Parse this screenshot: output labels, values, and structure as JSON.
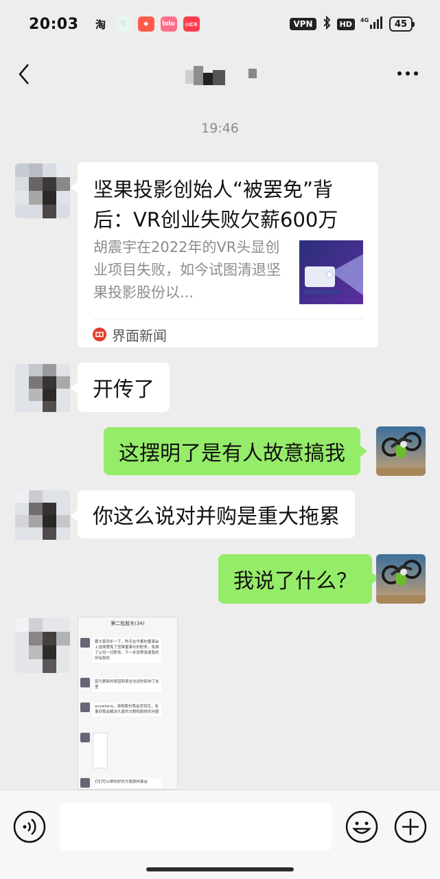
{
  "status_bar": {
    "time": "20:03",
    "app_icons": [
      "淘",
      "♡",
      "◆",
      "lolo",
      "小红书"
    ],
    "vpn": "VPN",
    "bluetooth": "bluetooth-icon",
    "hd": "HD",
    "signal": "⁴ᴳ.ıl",
    "battery": "45"
  },
  "nav": {
    "back_icon": "chevron-left-icon",
    "more_icon": "more-horizontal-icon"
  },
  "chat": {
    "timestamp": "19:46",
    "link_card": {
      "title": "坚果投影创始人“被罢免”背后：VR创业失败欠薪600万",
      "description": "胡震宇在2022年的VR头显创业项目失败，如今试图清退坚果投影股份以...",
      "source": "界面新闻"
    },
    "messages": [
      {
        "side": "left",
        "text": "开传了"
      },
      {
        "side": "right",
        "text": "这摆明了是有人故意搞我"
      },
      {
        "side": "left",
        "text": "你这么说对并购是重大拖累"
      },
      {
        "side": "right",
        "text": "我说了什么？"
      }
    ],
    "image_message": {
      "header": "第二批股东(34)",
      "rows": [
        {
          "text": "跟大家同步一下，昨天在华菱的董事会上选择罢免了坚果董事长的职务，免掉了公司一切职务，下一步就等清退我的所有股份"
        },
        {
          "text": "因为更新的原因和很全访谈的影响了这里"
        },
        {
          "text": "anywhere，请相股份我会受到压，有事到我会解决大家的欠薪和股债的问题"
        },
        {
          "text": ""
        },
        {
          "text": "们们可以帮你好的为我那样事会"
        }
      ]
    }
  },
  "input_bar": {
    "voice_icon": "voice-icon",
    "placeholder": "",
    "emoji_icon": "emoji-icon",
    "plus_icon": "plus-icon"
  },
  "colors": {
    "background": "#ededed",
    "bubble_self": "#95ec69",
    "bubble_other": "#ffffff"
  }
}
